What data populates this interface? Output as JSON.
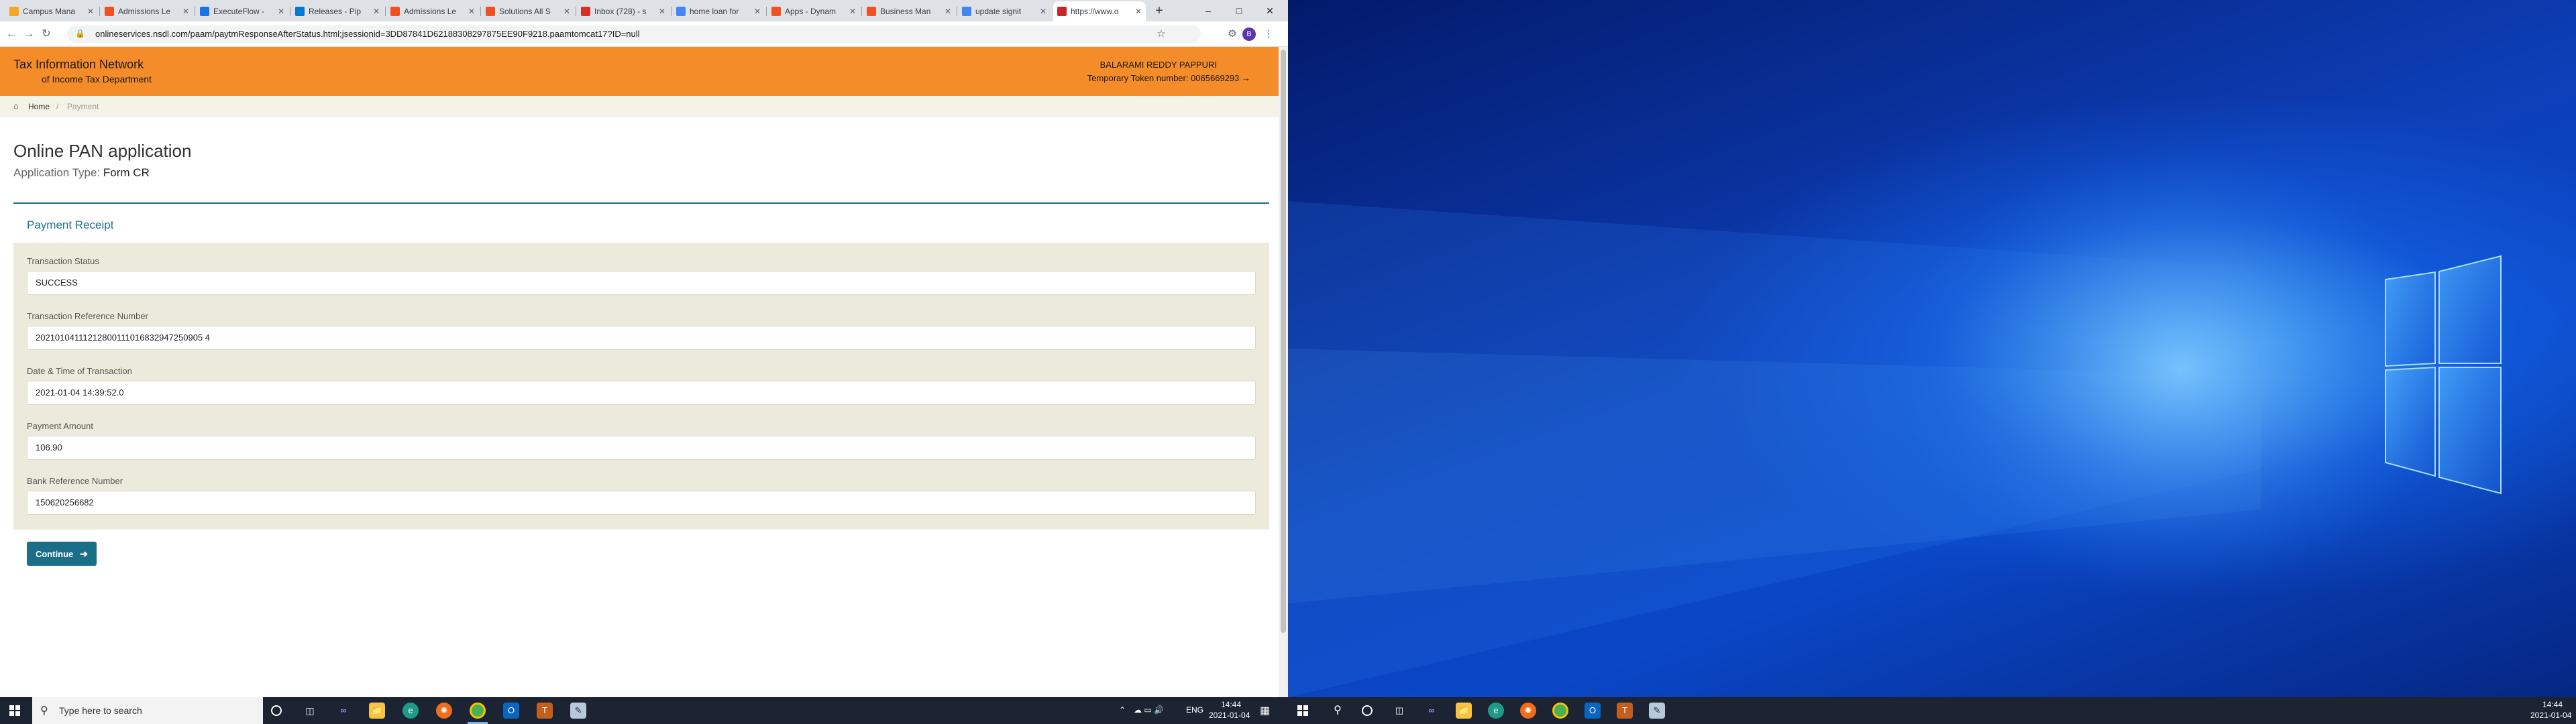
{
  "browser": {
    "tabs": [
      {
        "label": "Campus Mana",
        "icon": "orange-square-icon",
        "color": "#f5a623"
      },
      {
        "label": "Admissions Le",
        "icon": "ms-grid-icon",
        "color": "#f25022"
      },
      {
        "label": "ExecuteFlow -",
        "icon": "flow-icon",
        "color": "#1a73e8"
      },
      {
        "label": "Releases - Pip",
        "icon": "azure-devops-icon",
        "color": "#0078d4"
      },
      {
        "label": "Admissions Le",
        "icon": "ms-grid-icon",
        "color": "#f25022"
      },
      {
        "label": "Solutions All S",
        "icon": "ms-grid-icon",
        "color": "#f25022"
      },
      {
        "label": "Inbox (728) - s",
        "icon": "gmail-icon",
        "color": "#d93025"
      },
      {
        "label": "home loan for",
        "icon": "google-icon",
        "color": "#4285f4"
      },
      {
        "label": "Apps - Dynam",
        "icon": "ms-grid-icon",
        "color": "#f25022"
      },
      {
        "label": "Business Man",
        "icon": "ms-grid-icon",
        "color": "#f25022"
      },
      {
        "label": "update signit",
        "icon": "google-icon",
        "color": "#4285f4"
      },
      {
        "label": "https://www.o",
        "icon": "nsdl-icon",
        "color": "#c62828",
        "active": true
      }
    ],
    "url": "onlineservices.nsdl.com/paam/paytmResponseAfterStatus.html;jsessionid=3DD87841D62188308297875EE90F9218.paamtomcat17?ID=null",
    "profile_initial": "B"
  },
  "site": {
    "logo_line1": "Tax Information Network",
    "logo_line2": "of Income Tax Department",
    "user_name": "BALARAMI REDDY PAPPURI",
    "token": "Temporary Token number: 0065669293 →",
    "header_color": "#f58c2a"
  },
  "breadcrumb": {
    "home": "Home",
    "separator": "/",
    "current": "Payment"
  },
  "page": {
    "title": "Online PAN application",
    "app_type_label": "Application Type:",
    "app_type_value": "Form CR"
  },
  "receipt": {
    "heading": "Payment Receipt",
    "fields": [
      {
        "label": "Transaction Status",
        "value": "SUCCESS"
      },
      {
        "label": "Transaction Reference Number",
        "value": "20210104111212800111016832947250905 4"
      },
      {
        "label": "Date & Time of Transaction",
        "value": "2021-01-04 14:39:52.0"
      },
      {
        "label": "Payment Amount",
        "value": "106.90"
      },
      {
        "label": "Bank Reference Number",
        "value": "150620256682"
      }
    ]
  },
  "actions": {
    "continue": "Continue"
  },
  "taskbar": {
    "search_placeholder": "Type here to search",
    "lang": "ENG",
    "time": "14:44",
    "date": "2021-01-04"
  }
}
